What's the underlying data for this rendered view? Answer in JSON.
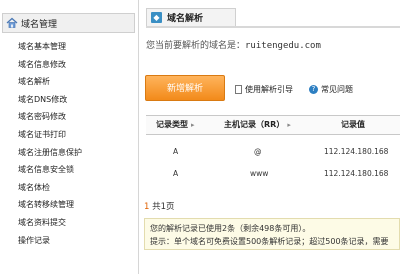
{
  "sidebar": {
    "title": "域名管理",
    "items": [
      {
        "label": "域名基本管理"
      },
      {
        "label": "域名信息修改"
      },
      {
        "label": "域名解析"
      },
      {
        "label": "域名DNS修改"
      },
      {
        "label": "域名密码修改"
      },
      {
        "label": "域名证书打印"
      },
      {
        "label": "域名注册信息保护"
      },
      {
        "label": "域名信息安全锁"
      },
      {
        "label": "域名体检"
      },
      {
        "label": "域名转移续管理"
      },
      {
        "label": "域名资料提交"
      },
      {
        "label": "操作记录"
      }
    ]
  },
  "main": {
    "tab_label": "域名解析",
    "domain_prefix": "您当前要解析的域名是：",
    "domain_value": "ruitengedu.com",
    "add_button_label": "新增解析",
    "guide_link": "使用解析引导",
    "faq_link": "常见问题"
  },
  "table": {
    "headers": {
      "type": "记录类型",
      "host": "主机记录（RR）",
      "value": "记录值"
    },
    "rows": [
      {
        "type": "A",
        "host": "@",
        "value": "112.124.180.168"
      },
      {
        "type": "A",
        "host": "www",
        "value": "112.124.180.168"
      }
    ]
  },
  "pager": {
    "count": "1",
    "text": "共1页"
  },
  "notice": {
    "line1": "您的解析记录已使用2条（剩余498条可用）。",
    "line2": "提示：单个域名可免费设置500条解析记录；超过500条记录，需要"
  },
  "icons": {
    "home": "home-icon",
    "tab": "dns-icon",
    "guide": "document-icon",
    "faq": "help-icon",
    "separator": "column-separator-icon"
  },
  "colors": {
    "accent": "#f28a1a",
    "link_blue": "#2d7fc2",
    "notice_bg": "#fdfbe6"
  }
}
